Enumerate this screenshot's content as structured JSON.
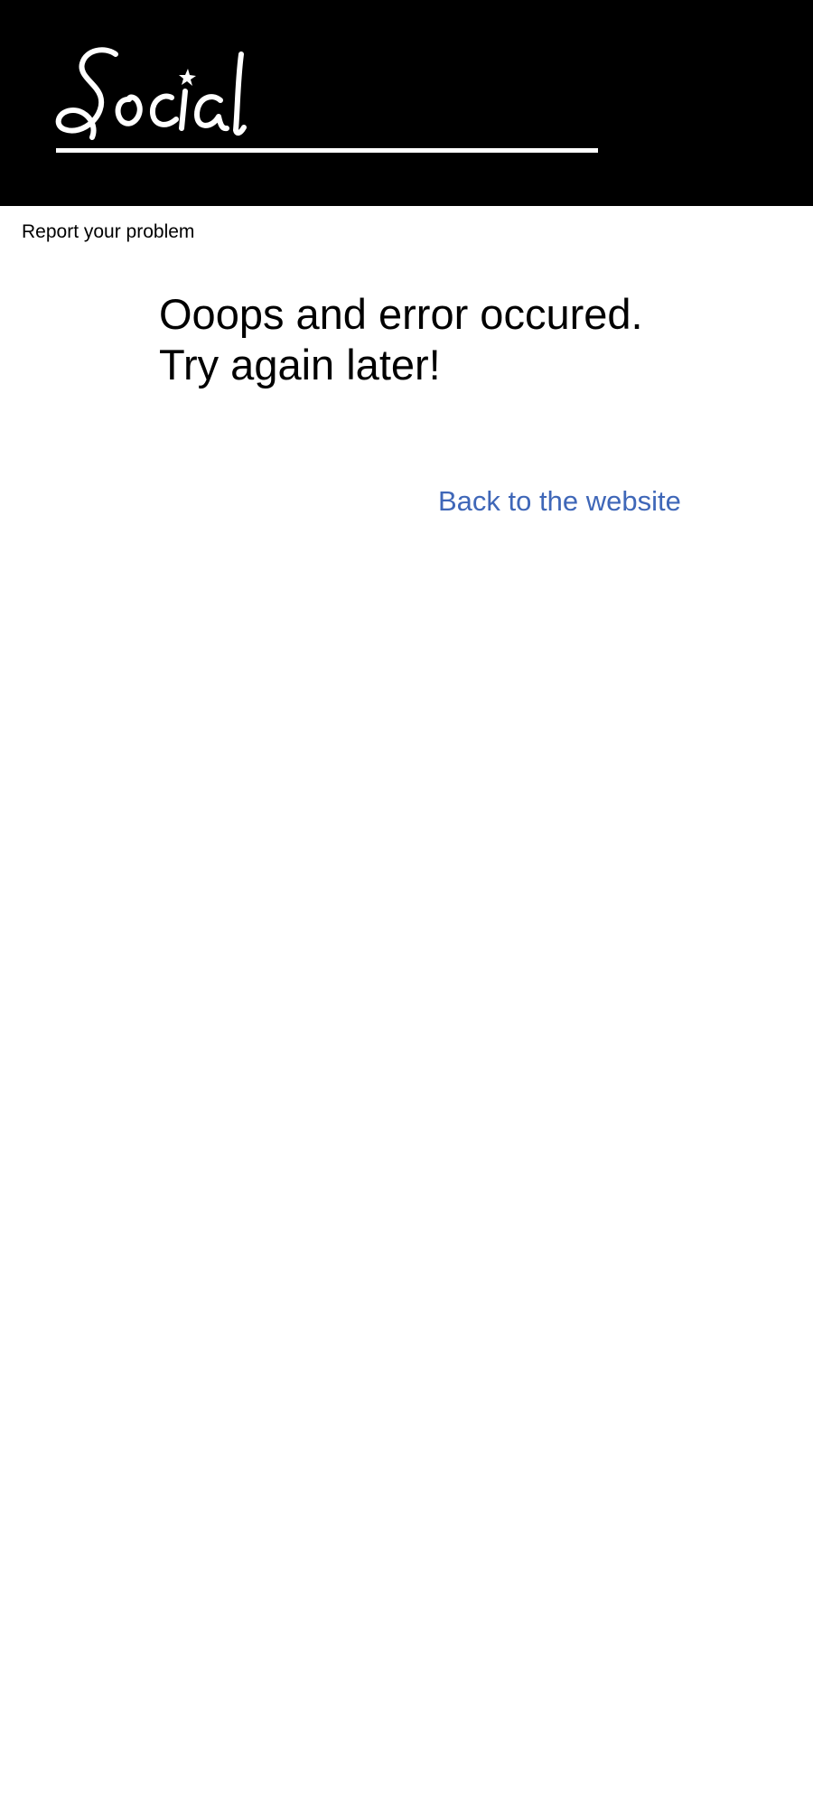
{
  "header": {
    "logo_text": "Social",
    "background_color": "#000000"
  },
  "report": {
    "label": "Report your problem"
  },
  "error": {
    "line1": "Ooops and error occured.",
    "line2": "Try again later!"
  },
  "back_link": {
    "label": "Back to the website",
    "color": "#3f67b8"
  }
}
